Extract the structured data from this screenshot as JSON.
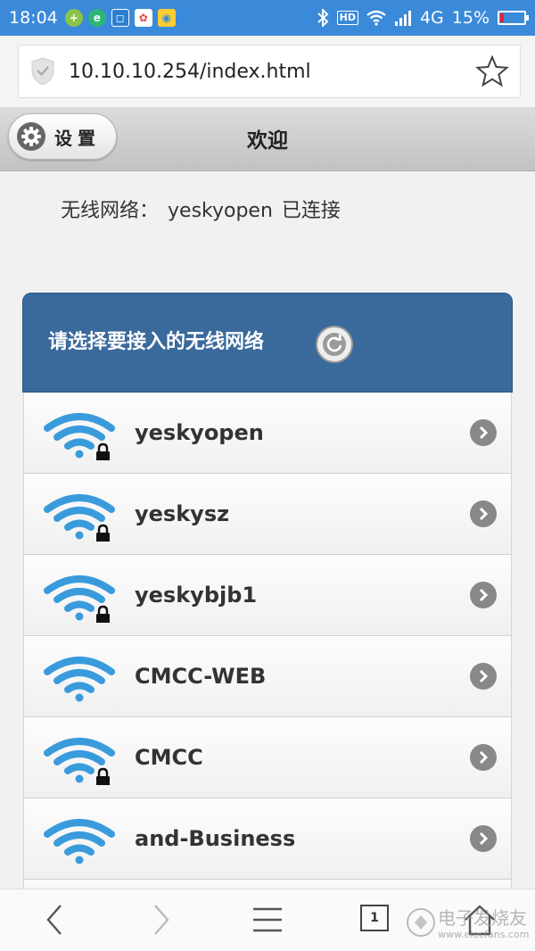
{
  "statusbar": {
    "time": "18:04",
    "hd": "HD",
    "network": "4G",
    "battery": "15%",
    "battery_fraction": 0.15,
    "colors": {
      "bg": "#3b8ad9",
      "battery_low": "#e23"
    }
  },
  "browser": {
    "url": "10.10.10.254/index.html",
    "tab_count": "1"
  },
  "header": {
    "settings_label": "设置",
    "title": "欢迎"
  },
  "status": {
    "label": "无线网络：",
    "ssid": "yeskyopen",
    "state": "已连接"
  },
  "panel": {
    "title": "请选择要接入的无线网络"
  },
  "networks": [
    {
      "ssid": "yeskyopen",
      "locked": true
    },
    {
      "ssid": "yeskysz",
      "locked": true
    },
    {
      "ssid": "yeskybjb1",
      "locked": true
    },
    {
      "ssid": "CMCC-WEB",
      "locked": false
    },
    {
      "ssid": "CMCC",
      "locked": true
    },
    {
      "ssid": "and-Business",
      "locked": false
    }
  ],
  "watermark": {
    "line1": "电子发烧友",
    "line2": "www.elecfans.com"
  },
  "colors": {
    "panel_header": "#3a6a9c",
    "wifi_icon": "#3a9bdc",
    "chevron": "#888888"
  }
}
